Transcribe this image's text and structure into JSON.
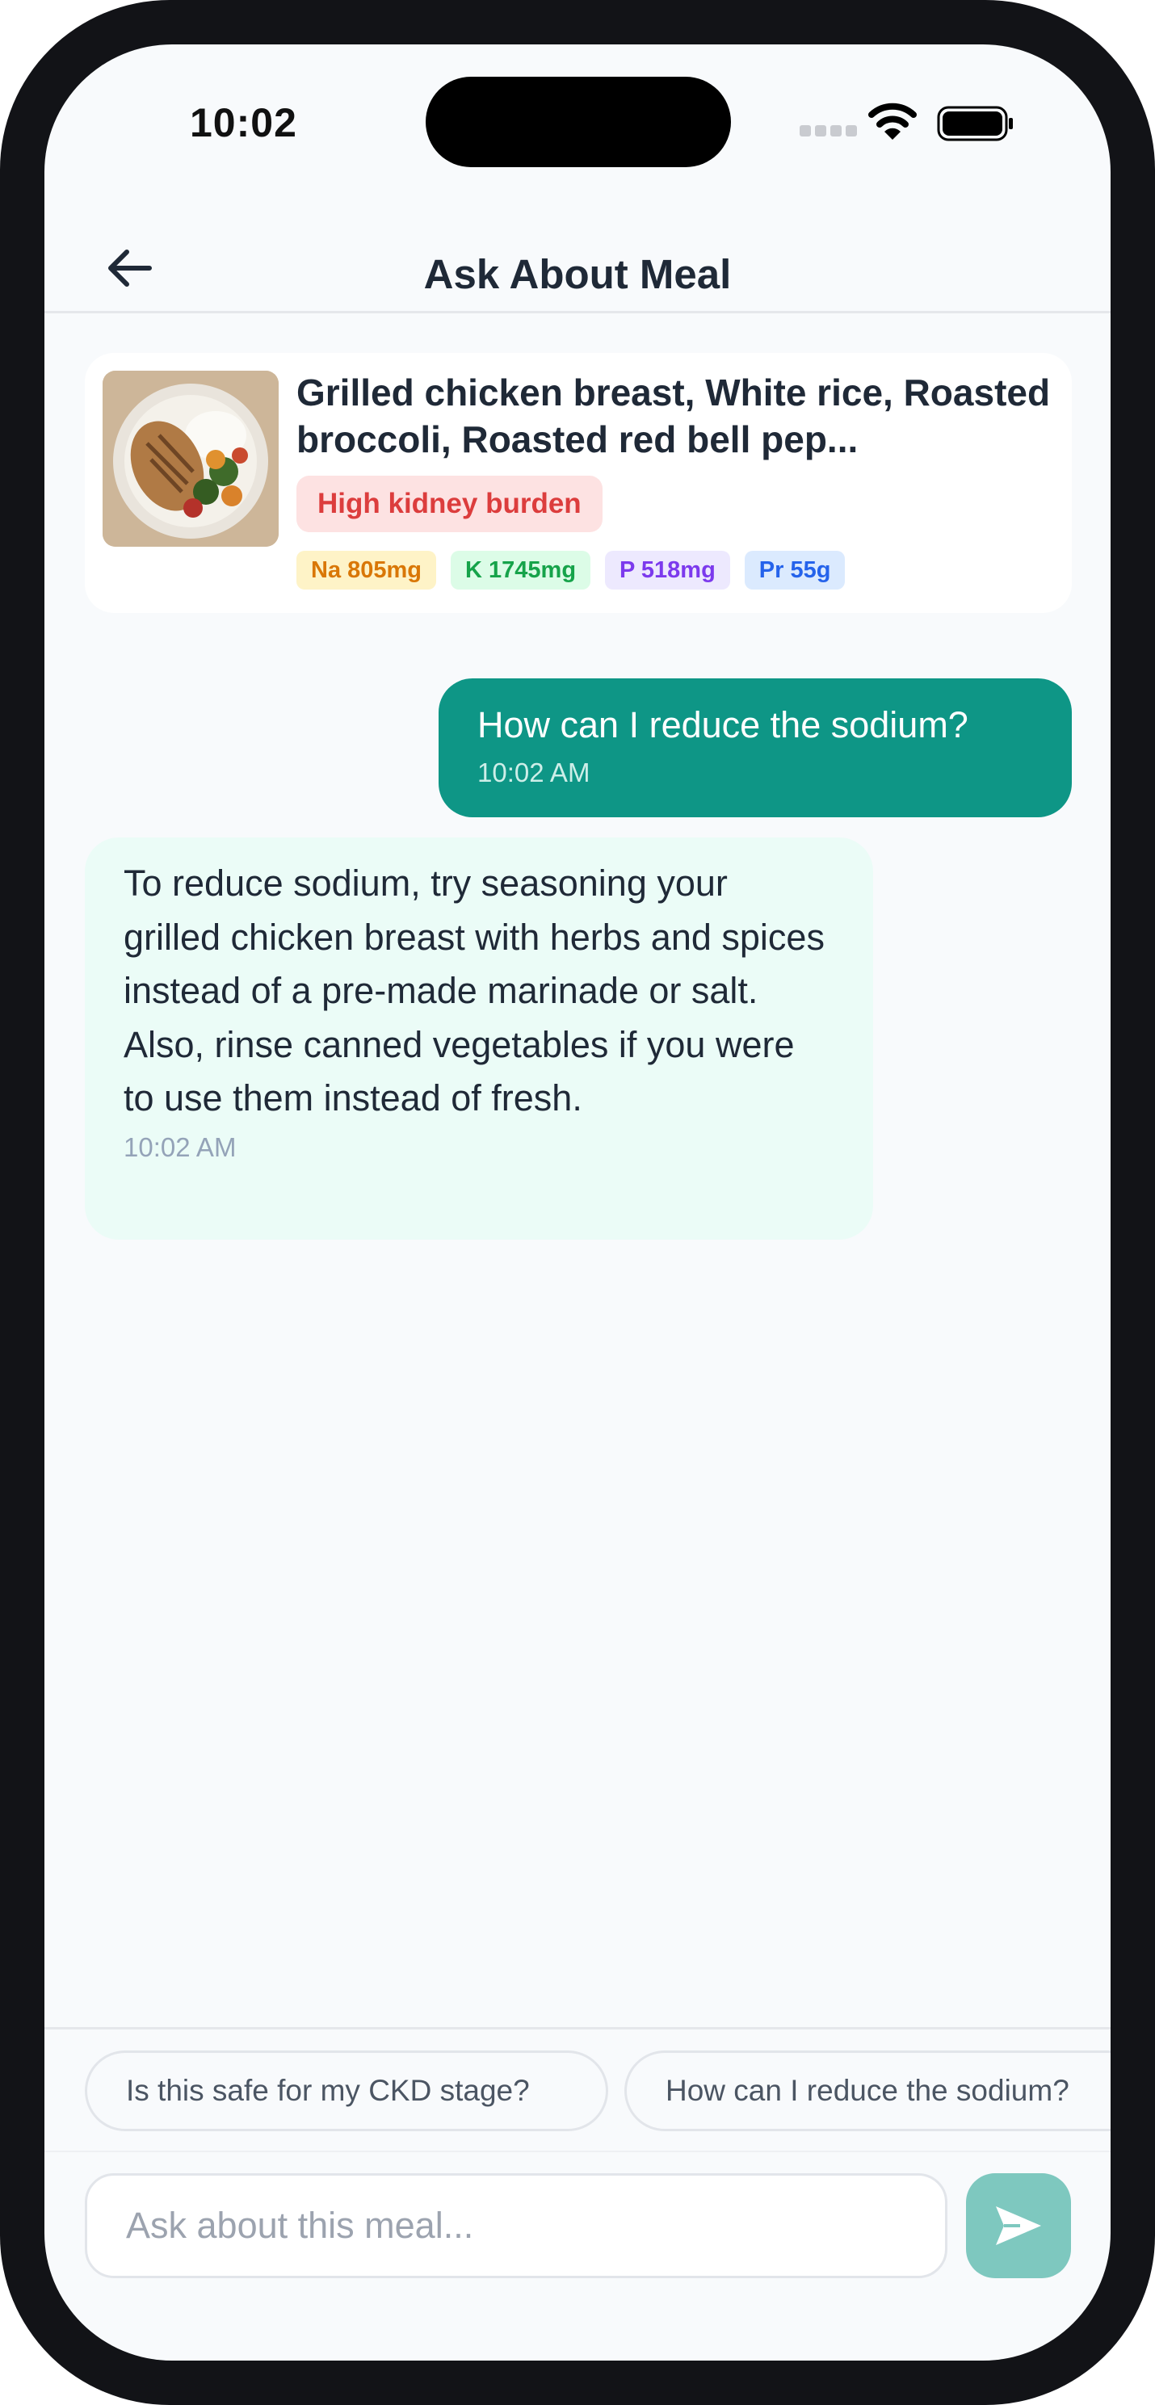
{
  "status_bar": {
    "time": "10:02"
  },
  "header": {
    "title": "Ask About Meal",
    "back_icon": "arrow-left-icon"
  },
  "meal": {
    "title": "Grilled chicken breast, White rice, Roasted broccoli, Roasted red bell pep...",
    "badge": "High kidney burden",
    "nutrients": [
      {
        "label": "Na 805mg",
        "color": "#d97706"
      },
      {
        "label": "K 1745mg",
        "color": "#16a34a"
      },
      {
        "label": "P 518mg",
        "color": "#7c3aed"
      },
      {
        "label": "Pr 55g",
        "color": "#2563eb"
      }
    ]
  },
  "messages": [
    {
      "role": "user",
      "text": "How can I reduce the sodium?",
      "time": "10:02 AM"
    },
    {
      "role": "assistant",
      "text": "To reduce sodium, try seasoning your grilled chicken breast with herbs and spices instead of a pre-made marinade or salt. Also, rinse canned vegetables if you were to use them instead of fresh.",
      "time": "10:02 AM"
    }
  ],
  "suggestions": [
    "Is this safe for my CKD stage?",
    "How can I reduce the sodium?"
  ],
  "composer": {
    "placeholder": "Ask about this meal...",
    "send_icon": "send-icon"
  },
  "colors": {
    "accent": "#0e9686",
    "danger": "#dc3d3d",
    "bot_bubble": "#ebfcf7"
  }
}
